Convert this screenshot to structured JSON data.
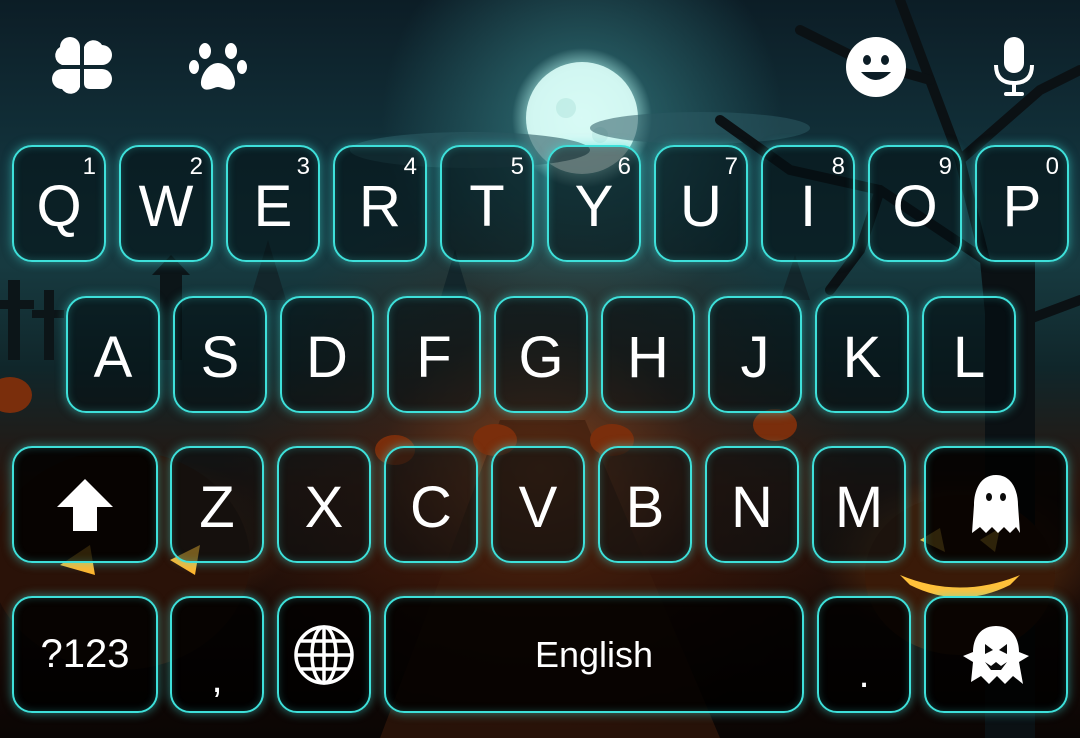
{
  "toolbar": {
    "icons": [
      "clover-icon",
      "paw-icon",
      "emoji-icon",
      "microphone-icon"
    ]
  },
  "rows": {
    "row1": [
      {
        "letter": "Q",
        "hint": "1"
      },
      {
        "letter": "W",
        "hint": "2"
      },
      {
        "letter": "E",
        "hint": "3"
      },
      {
        "letter": "R",
        "hint": "4"
      },
      {
        "letter": "T",
        "hint": "5"
      },
      {
        "letter": "Y",
        "hint": "6"
      },
      {
        "letter": "U",
        "hint": "7"
      },
      {
        "letter": "I",
        "hint": "8"
      },
      {
        "letter": "O",
        "hint": "9"
      },
      {
        "letter": "P",
        "hint": "0"
      }
    ],
    "row2": [
      "A",
      "S",
      "D",
      "F",
      "G",
      "H",
      "J",
      "K",
      "L"
    ],
    "row3": [
      "Z",
      "X",
      "C",
      "V",
      "B",
      "N",
      "M"
    ]
  },
  "bottom": {
    "symbols_label": "?123",
    "comma_label": ",",
    "space_label": "English",
    "period_label": "."
  },
  "colors": {
    "key_border": "#3ee0da",
    "key_text": "#ffffff"
  }
}
